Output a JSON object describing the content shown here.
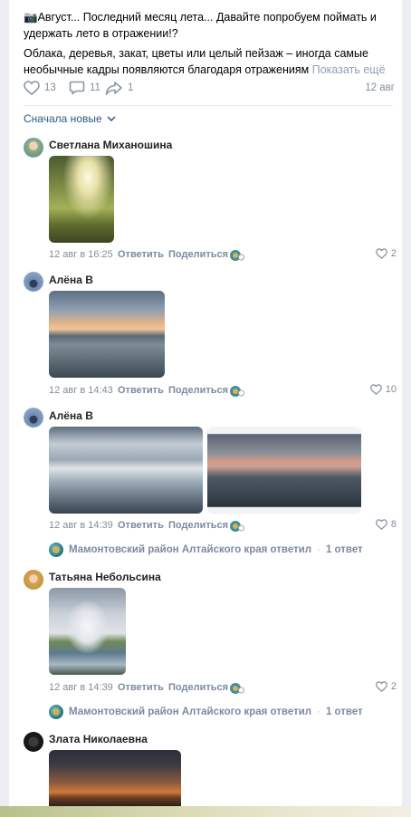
{
  "post": {
    "title_emoji": "📷",
    "title_text": "Август... Последний месяц лета... Давайте попробуем поймать и удержать лето в отражении!?",
    "body_text": "Облака, деревья, закат, цветы или целый пейзаж – иногда самые необычные кадры появляются благодаря отражениям",
    "more_link": "Показать ещё",
    "likes": "13",
    "comments": "11",
    "shares": "1",
    "date": "12 авг"
  },
  "sort_label": "Сначала новые",
  "comments": [
    {
      "author": "Светлана Миханошина",
      "time": "12 авг в 16:25",
      "reply": "Ответить",
      "share": "Поделиться",
      "likes": "2"
    },
    {
      "author": "Алёна В",
      "time": "12 авг в 14:43",
      "reply": "Ответить",
      "share": "Поделиться",
      "likes": "10"
    },
    {
      "author": "Алёна В",
      "time": "12 авг в 14:39",
      "reply": "Ответить",
      "share": "Поделиться",
      "likes": "8",
      "reply_thread": {
        "text": "Мамонтовский район Алтайского края ответил",
        "count": "1 ответ"
      }
    },
    {
      "author": "Татьяна Небольсина",
      "time": "12 авг в 14:39",
      "reply": "Ответить",
      "share": "Поделиться",
      "likes": "2",
      "reply_thread": {
        "text": "Мамонтовский район Алтайского края ответил",
        "count": "1 ответ"
      }
    },
    {
      "author": "Злата Николаевна"
    }
  ],
  "colors": {
    "link": "#2a5885",
    "meta": "#818c99",
    "accent_action": "#7c8aa0"
  },
  "icons": [
    "heart-icon",
    "comment-icon",
    "share-arrow-icon",
    "chevron-down-icon",
    "community-badge-icon"
  ]
}
